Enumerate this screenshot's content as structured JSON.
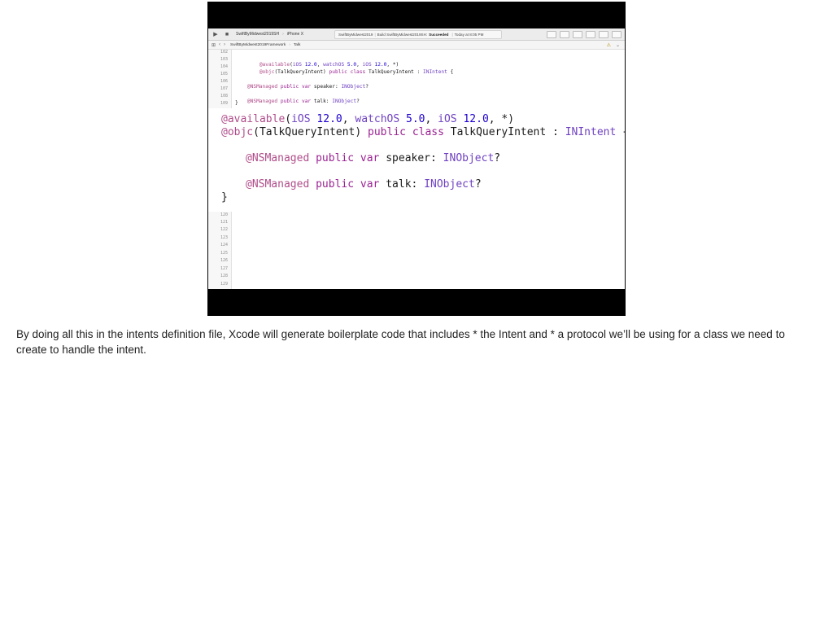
{
  "toolbar": {
    "scheme": "SwiftByMidwest2019SH",
    "device": "iPhone X",
    "status_project": "SwiftByMidwest2019",
    "status_build": "Build SwiftByMidwest2019SH:",
    "status_result": "Succeeded",
    "status_time": "Today at 8:05 PM"
  },
  "jumpbar": {
    "crumb_project": "SwiftByMidwest2019Framework",
    "crumb_file": "Talk"
  },
  "small_editor": {
    "line_numbers": [
      "102",
      "103",
      "104",
      "105",
      "106",
      "107",
      "108",
      "109"
    ],
    "lines": [
      "",
      "@available(iOS 12.0, watchOS 5.0, iOS 12.0, *)",
      "@objc(TalkQueryIntent) public class TalkQueryIntent : INIntent {",
      "",
      "    @NSManaged public var speaker: INObject?",
      "",
      "    @NSManaged public var talk: INObject?",
      "}"
    ]
  },
  "magnified": {
    "l1_attr": "@available",
    "l1_a": "(",
    "l1_ios": "iOS",
    "l1_n1": " 12.0",
    "l1_b": ", ",
    "l1_watch": "watchOS",
    "l1_n2": " 5.0",
    "l1_c": ", ",
    "l1_ios2": "iOS",
    "l1_n3": " 12.0",
    "l1_d": ", *)",
    "l2_attr": "@objc",
    "l2_a": "(TalkQueryIntent) ",
    "l2_kw1": "public",
    "l2_kw2": "class",
    "l2_name": "TalkQueryIntent : ",
    "l2_type": "INIntent",
    "l2_brace": " {",
    "l3_attr": "@NSManaged",
    "l3_kw1": "public",
    "l3_kw2": "var",
    "l3_name": "speaker: ",
    "l3_type": "INObject",
    "l3_q": "?",
    "l4_attr": "@NSManaged",
    "l4_kw1": "public",
    "l4_kw2": "var",
    "l4_name": "talk: ",
    "l4_type": "INObject",
    "l4_q": "?",
    "l5": "}"
  },
  "lower_editor": {
    "line_numbers": [
      "120",
      "121",
      "122",
      "123",
      "124",
      "125",
      "126",
      "127",
      "128",
      "129"
    ]
  },
  "caption": "By doing all this in the intents definition file, Xcode will generate boilerplate code that includes * the Intent and * a protocol we’ll be using for a class we need to create to handle the intent."
}
